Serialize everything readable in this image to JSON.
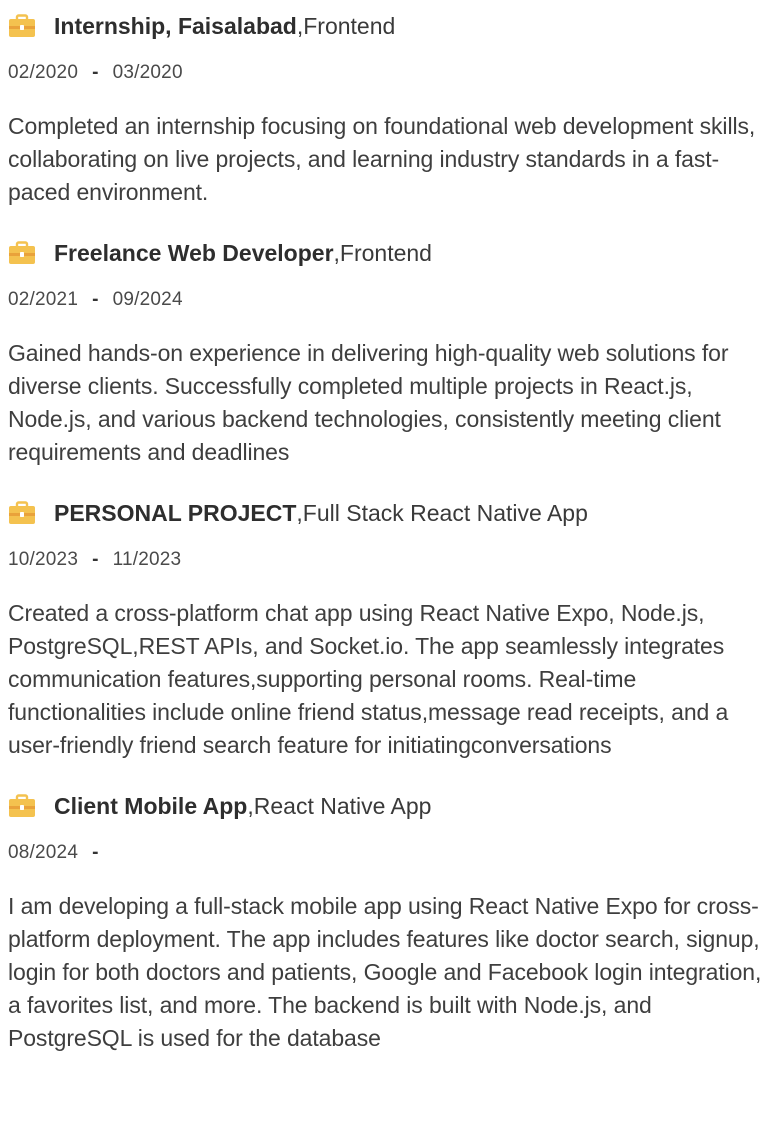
{
  "brand": {
    "icon_color": "#f4c24f",
    "icon_band_color": "#e9a23b"
  },
  "entries": [
    {
      "title": "Internship, Faisalabad",
      "role": "Frontend",
      "start": "02/2020",
      "end": "03/2020",
      "description": "Completed an internship focusing on foundational web development skills, collaborating on live projects, and learning industry standards in a fast-paced environment."
    },
    {
      "title": "Freelance Web Developer",
      "role": "Frontend",
      "start": "02/2021",
      "end": "09/2024",
      "description": "Gained hands-on experience in delivering high-quality web solutions for diverse clients. Successfully completed multiple projects in React.js, Node.js, and various backend technologies, consistently meeting client requirements and deadlines"
    },
    {
      "title": "PERSONAL PROJECT",
      "role": "Full Stack React Native App",
      "start": "10/2023",
      "end": "11/2023",
      "description": "Created a cross-platform chat app using React Native Expo, Node.js, PostgreSQL,REST APIs, and Socket.io. The app seamlessly integrates communication features,supporting personal rooms. Real-time functionalities include online friend status,message read receipts, and a user-friendly friend search feature for initiatingconversations"
    },
    {
      "title": "Client Mobile App",
      "role": "React Native App",
      "start": "08/2024",
      "end": "",
      "description": "I am developing a full-stack mobile app using React Native Expo for cross-platform deployment. The app includes features like doctor search, signup, login for both doctors and patients, Google and Facebook login integration, a favorites list, and more. The backend is built with Node.js, and PostgreSQL is used for the database"
    }
  ],
  "separators": {
    "role": ", ",
    "dates": "-"
  }
}
